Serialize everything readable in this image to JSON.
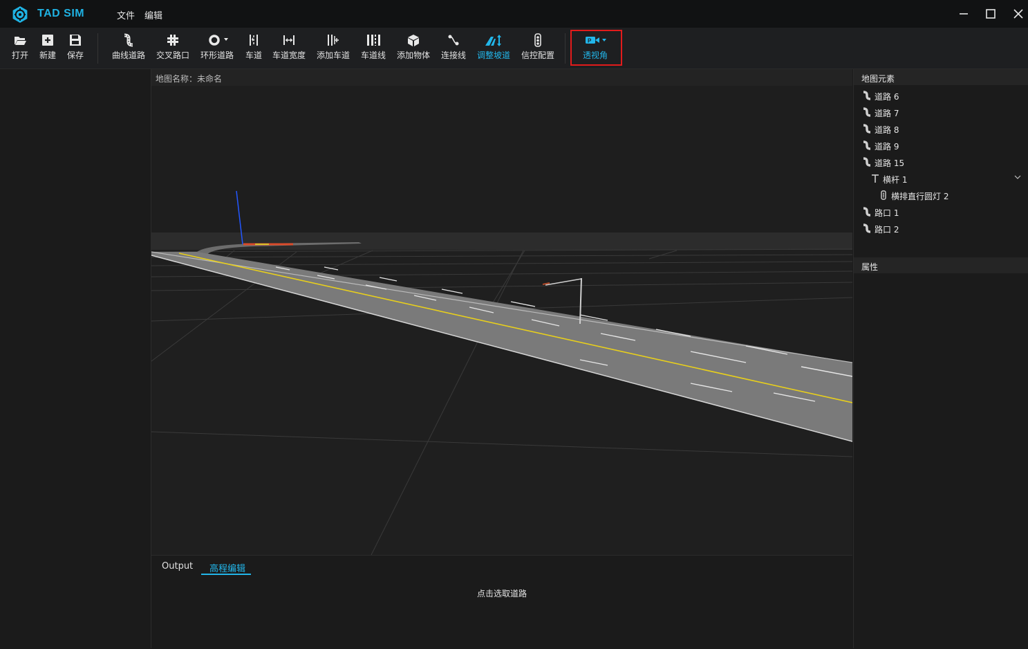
{
  "app": {
    "title": "TAD SIM",
    "accent": "#22b6ea"
  },
  "menu": [
    {
      "label": "文件"
    },
    {
      "label": "编辑"
    }
  ],
  "toolbar": {
    "items": [
      {
        "label": "打开",
        "icon": "folder-open-icon"
      },
      {
        "label": "新建",
        "icon": "new-file-icon"
      },
      {
        "label": "保存",
        "icon": "save-icon"
      },
      {
        "label": "曲线道路",
        "icon": "curve-road-icon"
      },
      {
        "label": "交叉路口",
        "icon": "junction-icon"
      },
      {
        "label": "环形道路",
        "icon": "ring-road-icon"
      },
      {
        "label": "车道",
        "icon": "lane-icon"
      },
      {
        "label": "车道宽度",
        "icon": "lane-width-icon"
      },
      {
        "label": "添加车道",
        "icon": "add-lane-icon"
      },
      {
        "label": "车道线",
        "icon": "lane-line-icon"
      },
      {
        "label": "添加物体",
        "icon": "add-object-icon"
      },
      {
        "label": "连接线",
        "icon": "connect-line-icon"
      },
      {
        "label": "调整坡道",
        "icon": "adjust-slope-icon",
        "active": true
      },
      {
        "label": "信控配置",
        "icon": "traffic-light-icon"
      },
      {
        "label": "透视角",
        "icon": "camera-icon",
        "active": true
      }
    ]
  },
  "viewport": {
    "map_name_label": "地图名称：未命名"
  },
  "bottom": {
    "tabs": [
      {
        "label": "Output"
      },
      {
        "label": "高程编辑",
        "active": true
      }
    ],
    "hint": "点击选取道路"
  },
  "right": {
    "map_elements_title": "地图元素",
    "items": [
      {
        "label": "道路 6",
        "icon": "road-icon"
      },
      {
        "label": "道路 7",
        "icon": "road-icon"
      },
      {
        "label": "道路 8",
        "icon": "road-icon"
      },
      {
        "label": "道路 9",
        "icon": "road-icon"
      },
      {
        "label": "道路 15",
        "icon": "road-icon"
      },
      {
        "label": "横杆 1",
        "icon": "pole-icon"
      },
      {
        "label": "横排直行圆灯 2",
        "icon": "traffic-light-icon"
      },
      {
        "label": "路口 1",
        "icon": "road-icon"
      },
      {
        "label": "路口 2",
        "icon": "road-icon"
      }
    ],
    "properties_title": "属性"
  }
}
